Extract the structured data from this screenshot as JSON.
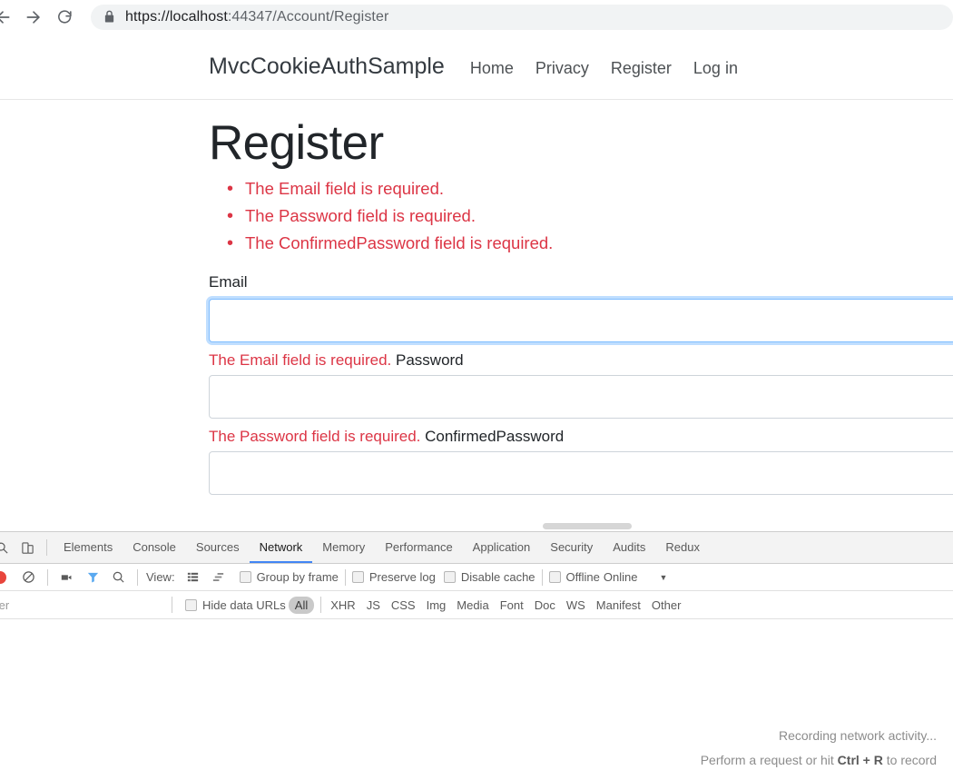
{
  "browser": {
    "url_scheme": "https://localhost",
    "url_rest": ":44347/Account/Register",
    "url_full": "https://localhost:44347/Account/Register",
    "back_icon": "back-arrow-icon",
    "forward_icon": "forward-arrow-icon",
    "reload_icon": "reload-icon",
    "lock_icon": "lock-icon"
  },
  "site": {
    "brand": "MvcCookieAuthSample",
    "nav": [
      {
        "label": "Home"
      },
      {
        "label": "Privacy"
      },
      {
        "label": "Register"
      },
      {
        "label": "Log in"
      }
    ]
  },
  "main": {
    "title": "Register",
    "validation_summary": [
      "The Email field is required.",
      "The Password field is required.",
      "The ConfirmedPassword field is required."
    ],
    "fields": {
      "email": {
        "label": "Email",
        "value": "",
        "error": "The Email field is required."
      },
      "password": {
        "label": "Password",
        "value": "",
        "error": "The Password field is required."
      },
      "confirmed_password": {
        "label": "ConfirmedPassword",
        "value": ""
      }
    }
  },
  "devtools": {
    "inspect_icon": "inspect-element-icon",
    "device_icon": "device-toolbar-icon",
    "tabs": [
      {
        "label": "Elements",
        "active": false
      },
      {
        "label": "Console",
        "active": false
      },
      {
        "label": "Sources",
        "active": false
      },
      {
        "label": "Network",
        "active": true
      },
      {
        "label": "Memory",
        "active": false
      },
      {
        "label": "Performance",
        "active": false
      },
      {
        "label": "Application",
        "active": false
      },
      {
        "label": "Security",
        "active": false
      },
      {
        "label": "Audits",
        "active": false
      },
      {
        "label": "Redux",
        "active": false
      }
    ],
    "toolbar": {
      "record_icon": "record-button-icon",
      "clear_icon": "clear-icon",
      "screenshot_icon": "camera-icon",
      "filter_icon": "funnel-icon",
      "search_icon": "search-icon",
      "view_label": "View:",
      "view_list_icon": "list-view-icon",
      "view_waterfall_icon": "waterfall-view-icon",
      "group_by_frame": "Group by frame",
      "preserve_log": "Preserve log",
      "disable_cache": "Disable cache",
      "offline": "Offline",
      "throttling": "Online",
      "caret_icon": "chevron-down-icon"
    },
    "filterbar": {
      "filter_value": "ter",
      "hide_data_urls": "Hide data URLs",
      "types": [
        {
          "label": "All",
          "active": true
        },
        {
          "label": "XHR",
          "active": false
        },
        {
          "label": "JS",
          "active": false
        },
        {
          "label": "CSS",
          "active": false
        },
        {
          "label": "Img",
          "active": false
        },
        {
          "label": "Media",
          "active": false
        },
        {
          "label": "Font",
          "active": false
        },
        {
          "label": "Doc",
          "active": false
        },
        {
          "label": "WS",
          "active": false
        },
        {
          "label": "Manifest",
          "active": false
        },
        {
          "label": "Other",
          "active": false
        }
      ]
    },
    "empty_state": {
      "line1": "Recording network activity...",
      "line2_pre": "Perform a request or hit ",
      "line2_key": "Ctrl + R",
      "line2_post": " to record"
    }
  },
  "colors": {
    "accent": "#4285f4",
    "error": "#dc3545",
    "record": "#e8453c",
    "focus_border": "#80bdff"
  }
}
